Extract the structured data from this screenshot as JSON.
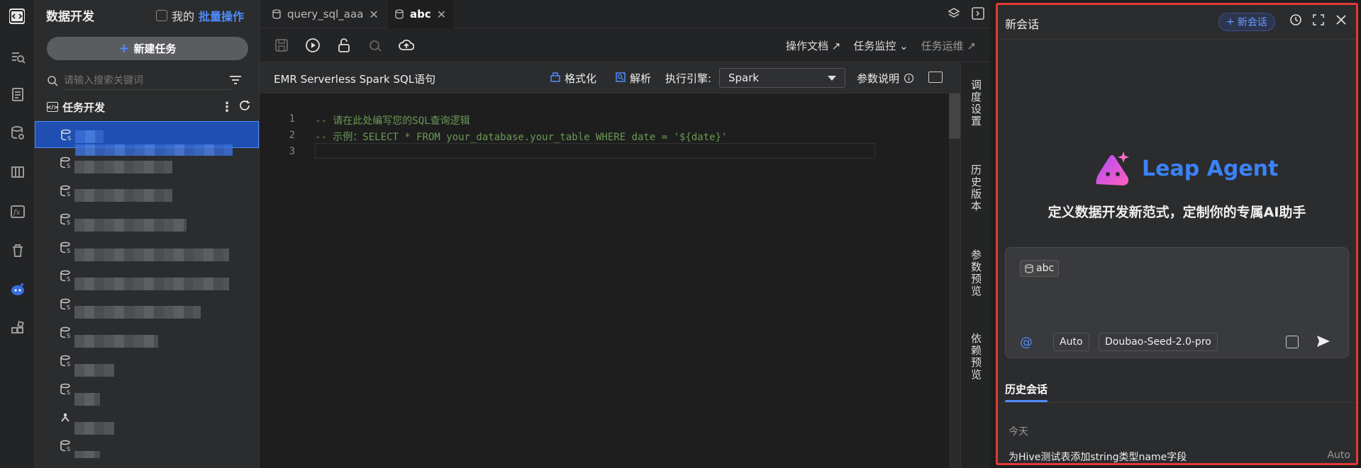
{
  "sidebar": {
    "title": "数据开发",
    "mine_label": "我的",
    "batch_label": "批量操作",
    "new_task_label": "新建任务",
    "search_placeholder": "请输入搜索关键词",
    "section_title": "任务开发"
  },
  "tabs": [
    {
      "label": "query_sql_aaa"
    },
    {
      "label": "abc"
    }
  ],
  "toolbar": {
    "links": [
      "操作文档 ↗",
      "任务监控 ⌄",
      "任务运维 ↗"
    ]
  },
  "sqlbar": {
    "title": "EMR Serverless Spark SQL语句",
    "format_label": "格式化",
    "parse_label": "解析",
    "engine_label": "执行引擎:",
    "engine_value": "Spark",
    "params_label": "参数说明"
  },
  "editor": {
    "lines": [
      {
        "no": "1",
        "text": "-- 请在此处编写您的SQL查询逻辑"
      },
      {
        "no": "2",
        "text": "-- 示例：SELECT * FROM your_database.your_table WHERE date = '${date}'"
      },
      {
        "no": "3",
        "text": ""
      }
    ]
  },
  "right_sidebar": [
    "调度设置",
    "历史版本",
    "参数预览",
    "依赖预览"
  ],
  "agent": {
    "header": "新会话",
    "new_chat_label": "新会话",
    "logo_name": "Leap Agent",
    "tagline": "定义数据开发新范式，定制你的专属AI助手",
    "chip_label": "abc",
    "mode_label": "Auto",
    "model_label": "Doubao-Seed-2.0-pro",
    "history_title": "历史会话",
    "today_label": "今天",
    "history_items": [
      {
        "title": "为Hive测试表添加string类型name字段",
        "mode": "Auto"
      }
    ]
  },
  "colors": {
    "accent": "#4d8cff",
    "highlight_border": "#e53935",
    "comment": "#6a9955"
  }
}
